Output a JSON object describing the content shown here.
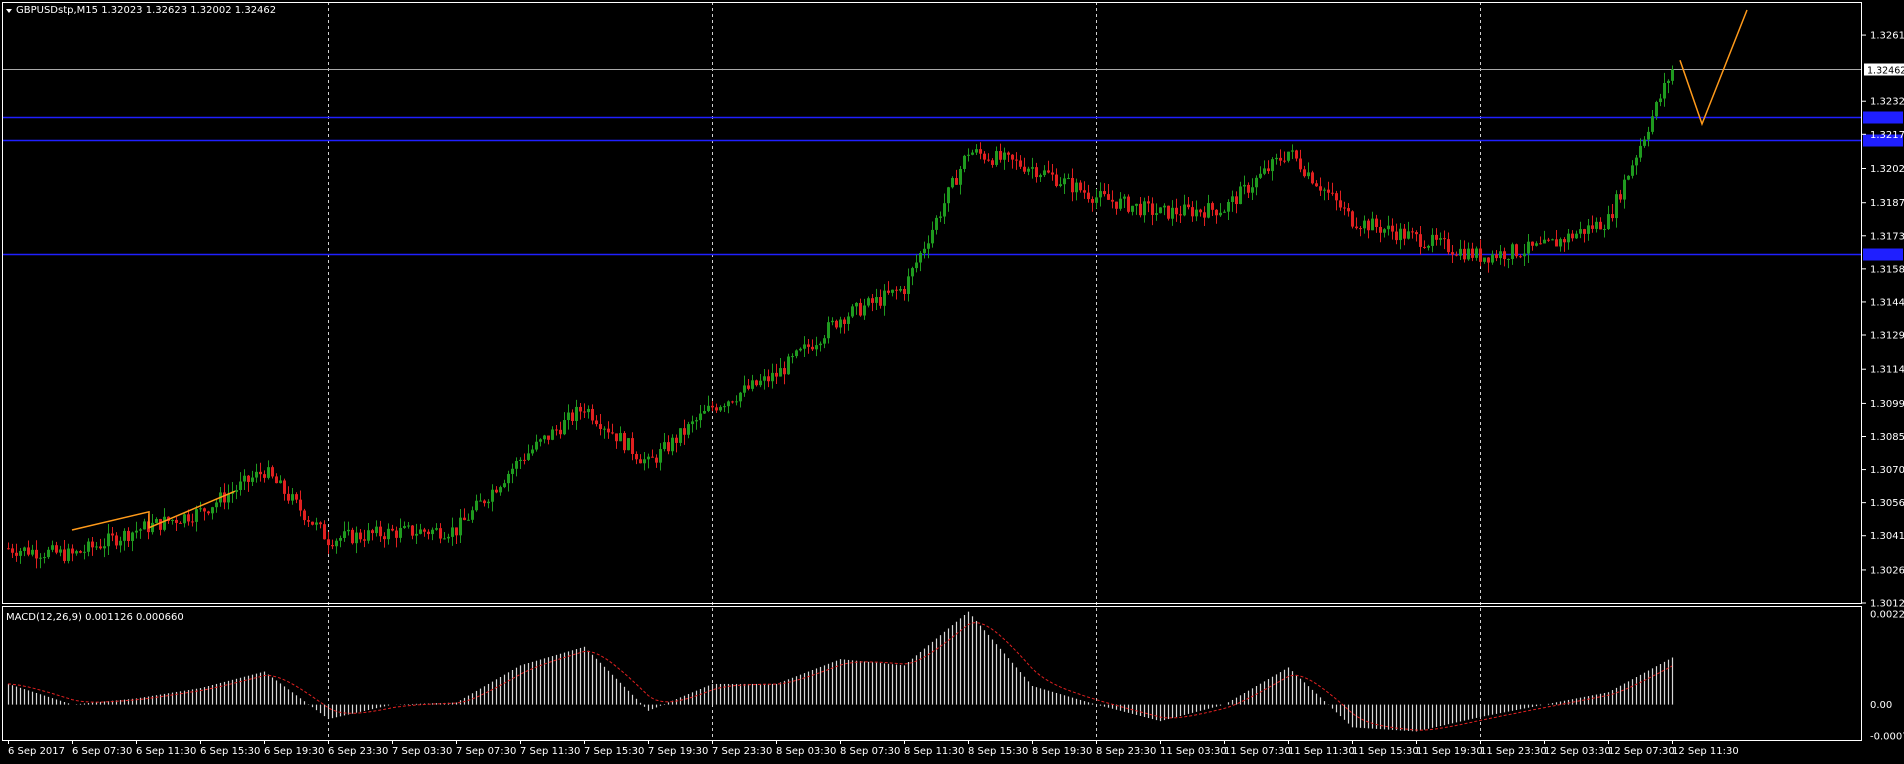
{
  "header": {
    "symbol_line": "GBPUSDstp,M15  1.32023 1.32623 1.32002 1.32462",
    "macd_line": "MACD(12,26,9) 0.001126 0.000660"
  },
  "colors": {
    "background": "#000000",
    "bull": "#1f9a1f",
    "bear": "#e02020",
    "level": "#1f1fff",
    "current_price": "#a9a9a9",
    "drawing": "#ff9a1a",
    "grid": "#d0d0d0",
    "macd_hist": "#d8d8d8",
    "macd_signal": "#e02020",
    "axis": "#ffffff"
  },
  "icons": {
    "symbol_menu": "triangle-down-icon"
  },
  "chart_data": [
    {
      "type": "line",
      "title": "GBPUSDstp,M15",
      "price_scale": {
        "ylim": [
          1.3012,
          1.32755
        ],
        "ticks": [
          "1.32610",
          "1.32320",
          "1.32175",
          "1.32025",
          "1.31875",
          "1.31730",
          "1.31585",
          "1.31440",
          "1.31295",
          "1.31145",
          "1.30995",
          "1.30850",
          "1.30705",
          "1.30560",
          "1.30415",
          "1.30265",
          "1.30120"
        ]
      },
      "current_price": {
        "value": 1.32462,
        "label": "1.32462"
      },
      "horizontal_levels": [
        1.3225,
        1.3215,
        1.3165
      ],
      "time_labels": [
        "6 Sep 2017",
        "6 Sep 07:30",
        "6 Sep 11:30",
        "6 Sep 15:30",
        "6 Sep 19:30",
        "6 Sep 23:30",
        "7 Sep 03:30",
        "7 Sep 07:30",
        "7 Sep 11:30",
        "7 Sep 15:30",
        "7 Sep 19:30",
        "7 Sep 23:30",
        "8 Sep 03:30",
        "8 Sep 07:30",
        "8 Sep 11:30",
        "8 Sep 15:30",
        "8 Sep 19:30",
        "8 Sep 23:30",
        "11 Sep 03:30",
        "11 Sep 07:30",
        "11 Sep 11:30",
        "11 Sep 15:30",
        "11 Sep 19:30",
        "11 Sep 23:30",
        "12 Sep 03:30",
        "12 Sep 07:30",
        "12 Sep 11:30"
      ],
      "day_separators": [
        "6 Sep 23:30",
        "7 Sep 23:30",
        "8 Sep 23:30",
        "11 Sep 23:30"
      ],
      "close_path": [
        {
          "t": "6 Sep 2017",
          "v": 1.3036
        },
        {
          "t": "6 Sep 07:30",
          "v": 1.3033
        },
        {
          "t": "6 Sep 11:30",
          "v": 1.3044
        },
        {
          "t": "6 Sep 15:30",
          "v": 1.3052
        },
        {
          "t": "6 Sep 19:30",
          "v": 1.307
        },
        {
          "t": "6 Sep 23:30",
          "v": 1.304
        },
        {
          "t": "7 Sep 03:30",
          "v": 1.3043
        },
        {
          "t": "7 Sep 07:30",
          "v": 1.3044
        },
        {
          "t": "7 Sep 11:30",
          "v": 1.3075
        },
        {
          "t": "7 Sep 15:30",
          "v": 1.3098
        },
        {
          "t": "7 Sep 19:30",
          "v": 1.3073
        },
        {
          "t": "7 Sep 23:30",
          "v": 1.3098
        },
        {
          "t": "8 Sep 03:30",
          "v": 1.3112
        },
        {
          "t": "8 Sep 07:30",
          "v": 1.3137
        },
        {
          "t": "8 Sep 11:30",
          "v": 1.315
        },
        {
          "t": "8 Sep 15:30",
          "v": 1.321
        },
        {
          "t": "8 Sep 19:30",
          "v": 1.3203
        },
        {
          "t": "8 Sep 23:30",
          "v": 1.319
        },
        {
          "t": "11 Sep 03:30",
          "v": 1.3183
        },
        {
          "t": "11 Sep 07:30",
          "v": 1.3185
        },
        {
          "t": "11 Sep 11:30",
          "v": 1.321
        },
        {
          "t": "11 Sep 15:30",
          "v": 1.318
        },
        {
          "t": "11 Sep 19:30",
          "v": 1.3172
        },
        {
          "t": "11 Sep 23:30",
          "v": 1.3164
        },
        {
          "t": "12 Sep 03:30",
          "v": 1.3168
        },
        {
          "t": "12 Sep 07:30",
          "v": 1.318
        },
        {
          "t": "12 Sep 11:30",
          "v": 1.3246
        }
      ],
      "drawings": [
        {
          "name": "zigzag-left",
          "points": [
            {
              "t": "6 Sep 07:30",
              "v": 1.3044
            },
            {
              "t": "6 Sep 11:30",
              "v": 1.3052
            },
            {
              "t": "6 Sep 11:30",
              "v": 1.3045
            },
            {
              "t": "6 Sep 15:30",
              "v": 1.3061
            }
          ]
        },
        {
          "name": "zigzag-right",
          "points": [
            {
              "t": "12 Sep 11:30",
              "v": 1.325
            },
            {
              "t": "12 Sep 11:30",
              "v": 1.3222
            },
            {
              "t": "12 Sep 11:30",
              "v": 1.3272
            }
          ]
        }
      ]
    },
    {
      "type": "bar",
      "title": "MACD(12,26,9)",
      "ylim": [
        -0.00076,
        0.00229
      ],
      "ticks": [
        "0.002295",
        "0.00",
        "-0.000766"
      ],
      "histogram_profile": [
        {
          "t": "6 Sep 2017",
          "v": 0.0005
        },
        {
          "t": "6 Sep 07:30",
          "v": 0.0
        },
        {
          "t": "6 Sep 11:30",
          "v": 0.00015
        },
        {
          "t": "6 Sep 15:30",
          "v": 0.0004
        },
        {
          "t": "6 Sep 19:30",
          "v": 0.0008
        },
        {
          "t": "6 Sep 23:30",
          "v": -0.00035
        },
        {
          "t": "7 Sep 03:30",
          "v": 0.0
        },
        {
          "t": "7 Sep 07:30",
          "v": 5e-05
        },
        {
          "t": "7 Sep 11:30",
          "v": 0.00095
        },
        {
          "t": "7 Sep 15:30",
          "v": 0.0014
        },
        {
          "t": "7 Sep 19:30",
          "v": -0.00015
        },
        {
          "t": "7 Sep 23:30",
          "v": 0.0005
        },
        {
          "t": "8 Sep 03:30",
          "v": 0.0005
        },
        {
          "t": "8 Sep 07:30",
          "v": 0.0011
        },
        {
          "t": "8 Sep 11:30",
          "v": 0.00095
        },
        {
          "t": "8 Sep 15:30",
          "v": 0.00225
        },
        {
          "t": "8 Sep 19:30",
          "v": 0.00045
        },
        {
          "t": "8 Sep 23:30",
          "v": 0.0
        },
        {
          "t": "11 Sep 03:30",
          "v": -0.0004
        },
        {
          "t": "11 Sep 07:30",
          "v": 0.0
        },
        {
          "t": "11 Sep 11:30",
          "v": 0.0009
        },
        {
          "t": "11 Sep 15:30",
          "v": -0.00055
        },
        {
          "t": "11 Sep 19:30",
          "v": -0.00065
        },
        {
          "t": "11 Sep 23:30",
          "v": -0.0003
        },
        {
          "t": "12 Sep 03:30",
          "v": 0.0
        },
        {
          "t": "12 Sep 07:30",
          "v": 0.0003
        },
        {
          "t": "12 Sep 11:30",
          "v": 0.00114
        }
      ]
    }
  ]
}
